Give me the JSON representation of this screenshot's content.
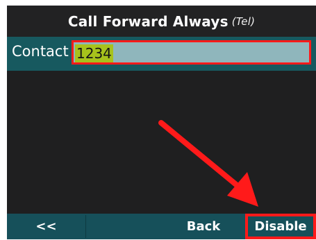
{
  "title": {
    "main": "Call Forward Always",
    "sub": "(Tel)"
  },
  "contact": {
    "label": "Contact",
    "value": "1234"
  },
  "softkeys": {
    "prev": "<<",
    "back": "Back",
    "disable": "Disable"
  },
  "colors": {
    "highlight_border": "#ff1a1a",
    "field_bg": "#8fb6bc",
    "selection_bg": "#a7c21c",
    "softkey_bar": "#16505a"
  }
}
